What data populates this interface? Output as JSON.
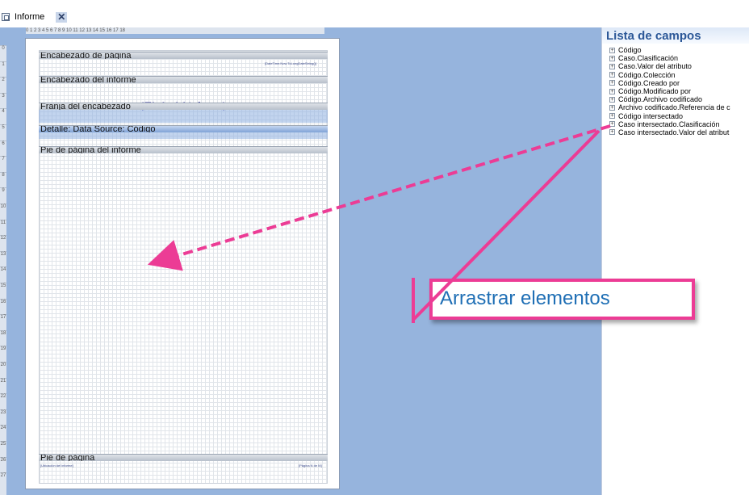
{
  "tab": {
    "label": "Informe",
    "close_label": "✕"
  },
  "ruler": {
    "h": "0  1  2  3  4  5  6  7  8  9  10  11  12  13  14  15  16  17  18",
    "v": [
      "0",
      "1",
      "2",
      "3",
      "4",
      "5",
      "6",
      "7",
      "8",
      "9",
      "10",
      "11",
      "12",
      "13",
      "14",
      "15",
      "16",
      "17",
      "18",
      "19",
      "20",
      "21",
      "22",
      "23",
      "24",
      "25",
      "26",
      "27"
    ]
  },
  "report": {
    "bands": {
      "page_header": "Encabezado de página",
      "report_header": "Encabezado del informe",
      "group_header": "Franja del encabezado",
      "detail": "Detalle: Data Source: Código",
      "report_footer": "Pie de página del informe",
      "page_footer": "Pie de página"
    },
    "date_expr": "[DateTime.Now.ToLongDateString()]",
    "title": "{Título del informe}",
    "footer_left": "[Ubicación del informe]",
    "footer_right": "[Página N de M]"
  },
  "fields_panel": {
    "title": "Lista de campos",
    "items": [
      "Código",
      "Caso.Clasificación",
      "Caso.Valor del atributo",
      "Código.Colección",
      "Código.Creado por",
      "Código.Modificado por",
      "Código.Archivo codificado",
      "Archivo codificado.Referencia de c",
      "Código intersectado",
      "Caso intersectado.Clasificación",
      "Caso intersectado.Valor del atribut"
    ]
  },
  "callout": {
    "text": "Arrastrar elementos"
  },
  "colors": {
    "accent": "#ec3c95",
    "designer_bg": "#96b4dd",
    "panel_title": "#2b5797",
    "callout_text": "#1f6fb5"
  }
}
